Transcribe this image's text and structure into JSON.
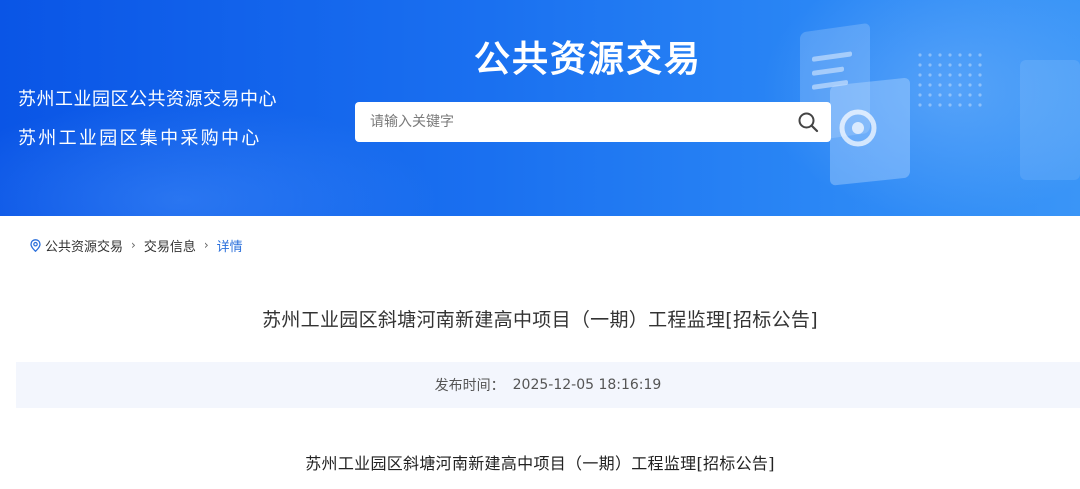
{
  "header": {
    "org_line_1": "苏州工业园区公共资源交易中心",
    "org_line_2": "苏州工业园区集中采购中心",
    "banner_title": "公共资源交易",
    "search": {
      "placeholder": "请输入关键字",
      "value": ""
    }
  },
  "breadcrumb": {
    "items": [
      "公共资源交易",
      "交易信息",
      "详情"
    ]
  },
  "article": {
    "title": "苏州工业园区斜塘河南新建高中项目（一期）工程监理[招标公告]",
    "meta_label": "发布时间：",
    "publish_time": "2025-12-05 18:16:19",
    "content_title": "苏州工业园区斜塘河南新建高中项目（一期）工程监理[招标公告]"
  },
  "colors": {
    "banner_primary": "#1a70f0",
    "accent_link": "#2a6fdb",
    "meta_bg": "#f3f6fd"
  },
  "icons": [
    "location-pin-icon",
    "chevron-right-icon",
    "search-icon"
  ]
}
